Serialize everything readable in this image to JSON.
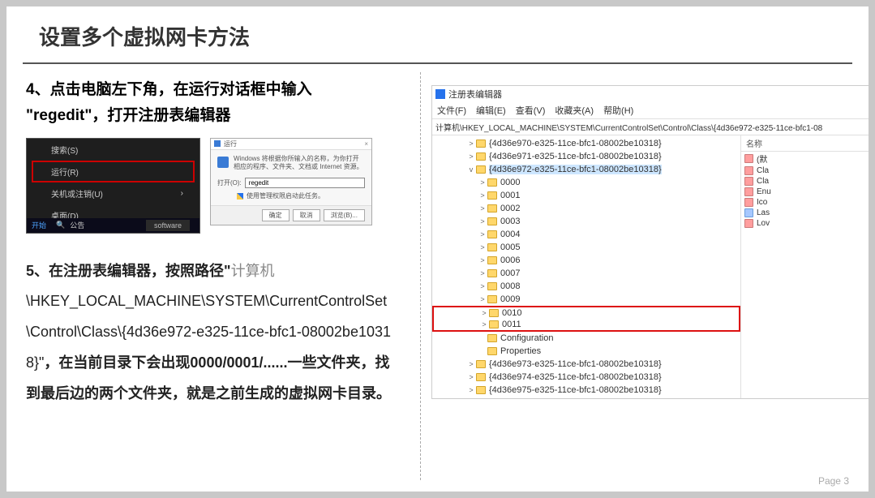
{
  "title": "设置多个虚拟网卡方法",
  "step4": {
    "number": "4、",
    "text_a": "点击电脑左下角，在运行对话框中输入",
    "quote_open": "\"",
    "regedit": "regedit",
    "quote_close": "\"",
    "text_b": "，打开注册表编辑器"
  },
  "start_menu": {
    "search": "搜索(S)",
    "run": "运行(R)",
    "shutdown": "关机或注销(U)",
    "arrow": "›",
    "desktop": "桌面(D)",
    "start_label": "开始",
    "announce": "公告",
    "software": "software"
  },
  "run_dialog": {
    "title": "运行",
    "close": "×",
    "msg": "Windows 将根据你所输入的名称，为你打开相应的程序、文件夹、文档或 Internet 资源。",
    "open_label": "打开(O):",
    "input_value": "regedit",
    "admin_msg": "使用管理权限启动此任务。",
    "ok": "确定",
    "cancel": "取消",
    "browse": "浏览(B)..."
  },
  "step5": {
    "number": "5、",
    "bold_a": "在注册表编辑器，按照路径\"",
    "gray": "计算机",
    "path": "\\HKEY_LOCAL_MACHINE\\SYSTEM\\CurrentControlSet\\Control\\Class\\{4d36e972-e325-11ce-bfc1-08002be10318}\"",
    "bold_b": "，在当前目录下会出现0000/0001/......一些文件夹，找到最后边的两个文件夹，就是之前生成的虚拟网卡目录。"
  },
  "regedit_win": {
    "title": "注册表编辑器",
    "menu": {
      "file": "文件(F)",
      "edit": "编辑(E)",
      "view": "查看(V)",
      "fav": "收藏夹(A)",
      "help": "帮助(H)"
    },
    "path_label": "计算机\\HKEY_LOCAL_MACHINE\\SYSTEM\\CurrentControlSet\\Control\\Class\\{4d36e972-e325-11ce-bfc1-08",
    "tree": [
      {
        "depth": 3,
        "exp": ">",
        "label": "{4d36e970-e325-11ce-bfc1-08002be10318}"
      },
      {
        "depth": 3,
        "exp": ">",
        "label": "{4d36e971-e325-11ce-bfc1-08002be10318}"
      },
      {
        "depth": 3,
        "exp": "v",
        "label": "{4d36e972-e325-11ce-bfc1-08002be10318}",
        "sel": true
      },
      {
        "depth": 4,
        "exp": ">",
        "label": "0000"
      },
      {
        "depth": 4,
        "exp": ">",
        "label": "0001"
      },
      {
        "depth": 4,
        "exp": ">",
        "label": "0002"
      },
      {
        "depth": 4,
        "exp": ">",
        "label": "0003"
      },
      {
        "depth": 4,
        "exp": ">",
        "label": "0004"
      },
      {
        "depth": 4,
        "exp": ">",
        "label": "0005"
      },
      {
        "depth": 4,
        "exp": ">",
        "label": "0006"
      },
      {
        "depth": 4,
        "exp": ">",
        "label": "0007"
      },
      {
        "depth": 4,
        "exp": ">",
        "label": "0008"
      },
      {
        "depth": 4,
        "exp": ">",
        "label": "0009"
      },
      {
        "depth": 4,
        "exp": ">",
        "label": "0010",
        "red": "top"
      },
      {
        "depth": 4,
        "exp": ">",
        "label": "0011",
        "red": "bot"
      },
      {
        "depth": 4,
        "exp": "",
        "label": "Configuration"
      },
      {
        "depth": 4,
        "exp": "",
        "label": "Properties"
      },
      {
        "depth": 3,
        "exp": ">",
        "label": "{4d36e973-e325-11ce-bfc1-08002be10318}"
      },
      {
        "depth": 3,
        "exp": ">",
        "label": "{4d36e974-e325-11ce-bfc1-08002be10318}"
      },
      {
        "depth": 3,
        "exp": ">",
        "label": "{4d36e975-e325-11ce-bfc1-08002be10318}"
      }
    ],
    "values_header": "名称",
    "values": [
      {
        "ico": "str",
        "name": "(默"
      },
      {
        "ico": "str",
        "name": "Cla"
      },
      {
        "ico": "str",
        "name": "Cla"
      },
      {
        "ico": "str",
        "name": "Enu"
      },
      {
        "ico": "str",
        "name": "Ico"
      },
      {
        "ico": "bin",
        "name": "Las"
      },
      {
        "ico": "str",
        "name": "Lov"
      }
    ]
  },
  "page_number": "Page 3"
}
